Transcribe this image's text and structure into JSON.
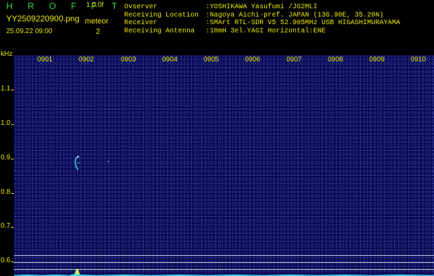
{
  "header": {
    "app_name": "H R O F F T",
    "app_version": "1.0.0f",
    "file_name": "YY2509220900.png",
    "datetime": "25.09.22 09:00",
    "meteor_label": "meteor",
    "meteor_count": "2"
  },
  "info": [
    {
      "label": "Ovserver",
      "value": ":YOSHIKAWA Yasufumi /JG2MLI"
    },
    {
      "label": "Receiving Location",
      "value": ":Nagoya Aichi-pref. JAPAN (136.90E, 35.20N)"
    },
    {
      "label": "Receiver",
      "value": ":SMArt RTL-SDR V5 52.905MHz USB HIGASHIMURAYAMA"
    },
    {
      "label": "Receiving Antenna",
      "value": ":10mH 3el.YAGI Horizontal:ENE"
    }
  ],
  "axis": {
    "unit": "kHz",
    "time_labels": [
      "0901",
      "0902",
      "0903",
      "0904",
      "0905",
      "0906",
      "0907",
      "0908",
      "0909",
      "0910"
    ],
    "freq_labels": [
      "1.1",
      "1.0",
      "0.9",
      "0.8",
      "0.7",
      "0.6"
    ]
  },
  "colors": {
    "text": "#e8e800",
    "title": "#2fd34a",
    "background": "#000000",
    "waterfall": "#0a0a52",
    "echo": "#3ad6e6",
    "spectrum": "#40e0f0"
  }
}
